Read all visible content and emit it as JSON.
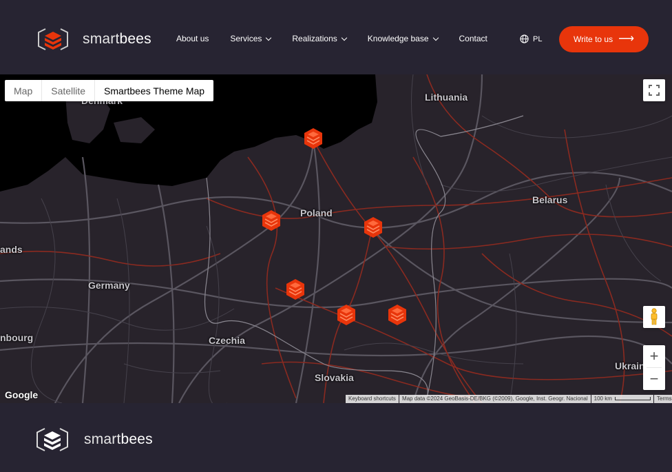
{
  "header": {
    "brand_light": "smart",
    "brand_bold": "bees",
    "nav": [
      {
        "label": "About us"
      },
      {
        "label": "Services"
      },
      {
        "label": "Realizations"
      },
      {
        "label": "Knowledge base"
      },
      {
        "label": "Contact"
      }
    ],
    "lang": "PL",
    "cta_label": "Write to us",
    "cta_arrow": "⟶",
    "accent_color": "#e8350b"
  },
  "map": {
    "types": [
      "Map",
      "Satellite",
      "Smartbees Theme Map"
    ],
    "active_type": "Smartbees Theme Map",
    "labels": {
      "lithuania": "Lithuania",
      "denmark": "Denmark",
      "poland": "Poland",
      "belarus": "Belarus",
      "germany": "Germany",
      "czechia": "Czechia",
      "slovakia": "Slovakia",
      "ukraine": "Ukrain",
      "netherlands": "ands",
      "luxembourg": "nbourg"
    },
    "zoom_in": "+",
    "zoom_out": "−",
    "google": "Google",
    "attribution": {
      "shortcuts": "Keyboard shortcuts",
      "data": "Map data ©2024 GeoBasis-DE/BKG (©2009), Google, Inst. Geogr. Nacional",
      "scale": "100 km",
      "terms": "Terms"
    }
  },
  "footer": {
    "brand_light": "smart",
    "brand_bold": "bees"
  }
}
